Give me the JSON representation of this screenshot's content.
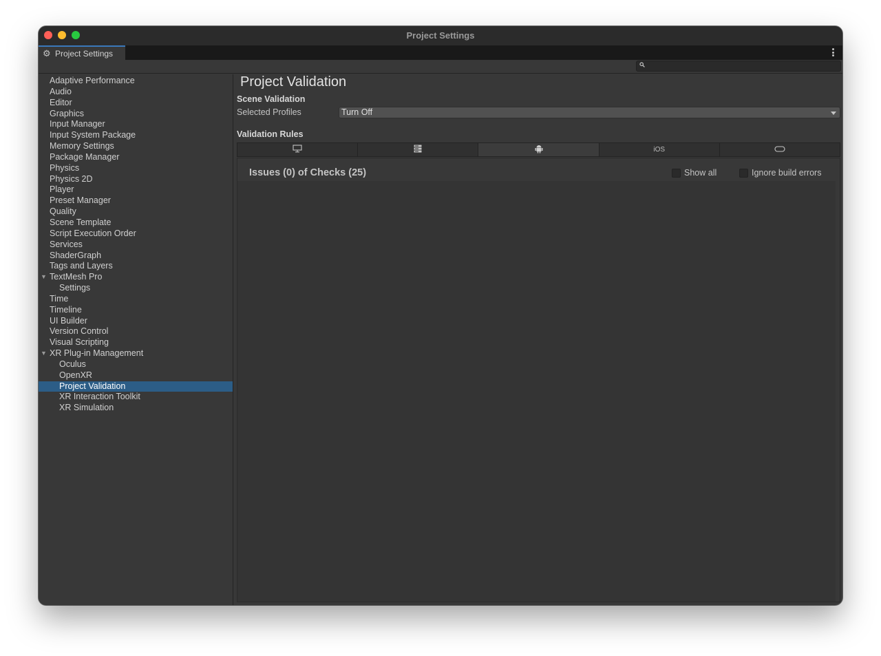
{
  "window": {
    "title": "Project Settings",
    "tab_label": "Project Settings",
    "tab_icon": "gear-icon"
  },
  "search": {
    "placeholder": "",
    "icon": "search-icon"
  },
  "sidebar": {
    "items": [
      {
        "label": "Adaptive Performance",
        "level": 0
      },
      {
        "label": "Audio",
        "level": 0
      },
      {
        "label": "Editor",
        "level": 0
      },
      {
        "label": "Graphics",
        "level": 0
      },
      {
        "label": "Input Manager",
        "level": 0
      },
      {
        "label": "Input System Package",
        "level": 0
      },
      {
        "label": "Memory Settings",
        "level": 0
      },
      {
        "label": "Package Manager",
        "level": 0
      },
      {
        "label": "Physics",
        "level": 0
      },
      {
        "label": "Physics 2D",
        "level": 0
      },
      {
        "label": "Player",
        "level": 0
      },
      {
        "label": "Preset Manager",
        "level": 0
      },
      {
        "label": "Quality",
        "level": 0
      },
      {
        "label": "Scene Template",
        "level": 0
      },
      {
        "label": "Script Execution Order",
        "level": 0
      },
      {
        "label": "Services",
        "level": 0
      },
      {
        "label": "ShaderGraph",
        "level": 0
      },
      {
        "label": "Tags and Layers",
        "level": 0
      },
      {
        "label": "TextMesh Pro",
        "level": 0,
        "expanded": true
      },
      {
        "label": "Settings",
        "level": 1
      },
      {
        "label": "Time",
        "level": 0
      },
      {
        "label": "Timeline",
        "level": 0
      },
      {
        "label": "UI Builder",
        "level": 0
      },
      {
        "label": "Version Control",
        "level": 0
      },
      {
        "label": "Visual Scripting",
        "level": 0
      },
      {
        "label": "XR Plug-in Management",
        "level": 0,
        "expanded": true
      },
      {
        "label": "Oculus",
        "level": 1
      },
      {
        "label": "OpenXR",
        "level": 1
      },
      {
        "label": "Project Validation",
        "level": 1,
        "selected": true
      },
      {
        "label": "XR Interaction Toolkit",
        "level": 1
      },
      {
        "label": "XR Simulation",
        "level": 1
      }
    ]
  },
  "main": {
    "title": "Project Validation",
    "scene_validation_label": "Scene Validation",
    "selected_profiles_label": "Selected Profiles",
    "selected_profiles_value": "Turn Off",
    "validation_rules_label": "Validation Rules",
    "platform_tabs": [
      {
        "icon": "desktop-icon",
        "label": "",
        "active": false
      },
      {
        "icon": "server-icon",
        "label": "",
        "active": false
      },
      {
        "icon": "android-icon",
        "label": "",
        "active": true
      },
      {
        "icon": "",
        "label": "iOS",
        "active": false
      },
      {
        "icon": "vr-headset-icon",
        "label": "",
        "active": false
      }
    ],
    "issues_title": "Issues (0) of Checks (25)",
    "show_all_label": "Show all",
    "ignore_build_errors_label": "Ignore build errors"
  },
  "colors": {
    "selection": "#2c5d87",
    "tab_accent": "#3a79bb",
    "window_bg": "#383838"
  }
}
